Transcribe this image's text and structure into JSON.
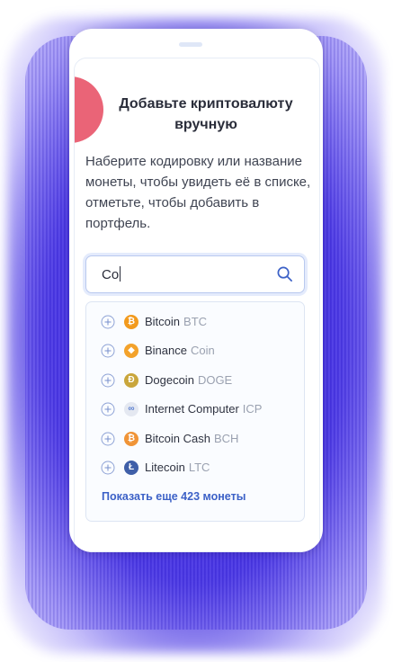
{
  "page": {
    "title": "Добавьте криптовалюту вручную",
    "description": "Наберите кодировку или название монеты, чтобы увидеть её в списке, отметьте, чтобы добавить в портфель."
  },
  "search": {
    "value": "Co",
    "icon": "search-icon"
  },
  "results": [
    {
      "name": "Bitcoin",
      "ticker": "BTC",
      "symbol": "₿",
      "color": "#f29a1d",
      "icon": "bitcoin-icon"
    },
    {
      "name": "Binance",
      "ticker": "Coin",
      "symbol": "◆",
      "color": "#f3a22b",
      "icon": "binance-icon"
    },
    {
      "name": "Dogecoin",
      "ticker": "DOGE",
      "symbol": "Ð",
      "color": "#c9a63c",
      "icon": "dogecoin-icon"
    },
    {
      "name": "Internet Computer",
      "ticker": "ICP",
      "symbol": "∞",
      "color": "#e4e8f1",
      "icon": "internet-computer-icon"
    },
    {
      "name": "Bitcoin Cash",
      "ticker": "BCH",
      "symbol": "₿",
      "color": "#f09437",
      "icon": "bitcoin-cash-icon"
    },
    {
      "name": "Litecoin",
      "ticker": "LTC",
      "symbol": "Ł",
      "color": "#3f5fa8",
      "icon": "litecoin-icon"
    }
  ],
  "show_more": "Показать еще 423 монеты",
  "colors": {
    "accent": "#3c61c7",
    "decoration": "#ea6477",
    "glow": "#3a22dc"
  }
}
